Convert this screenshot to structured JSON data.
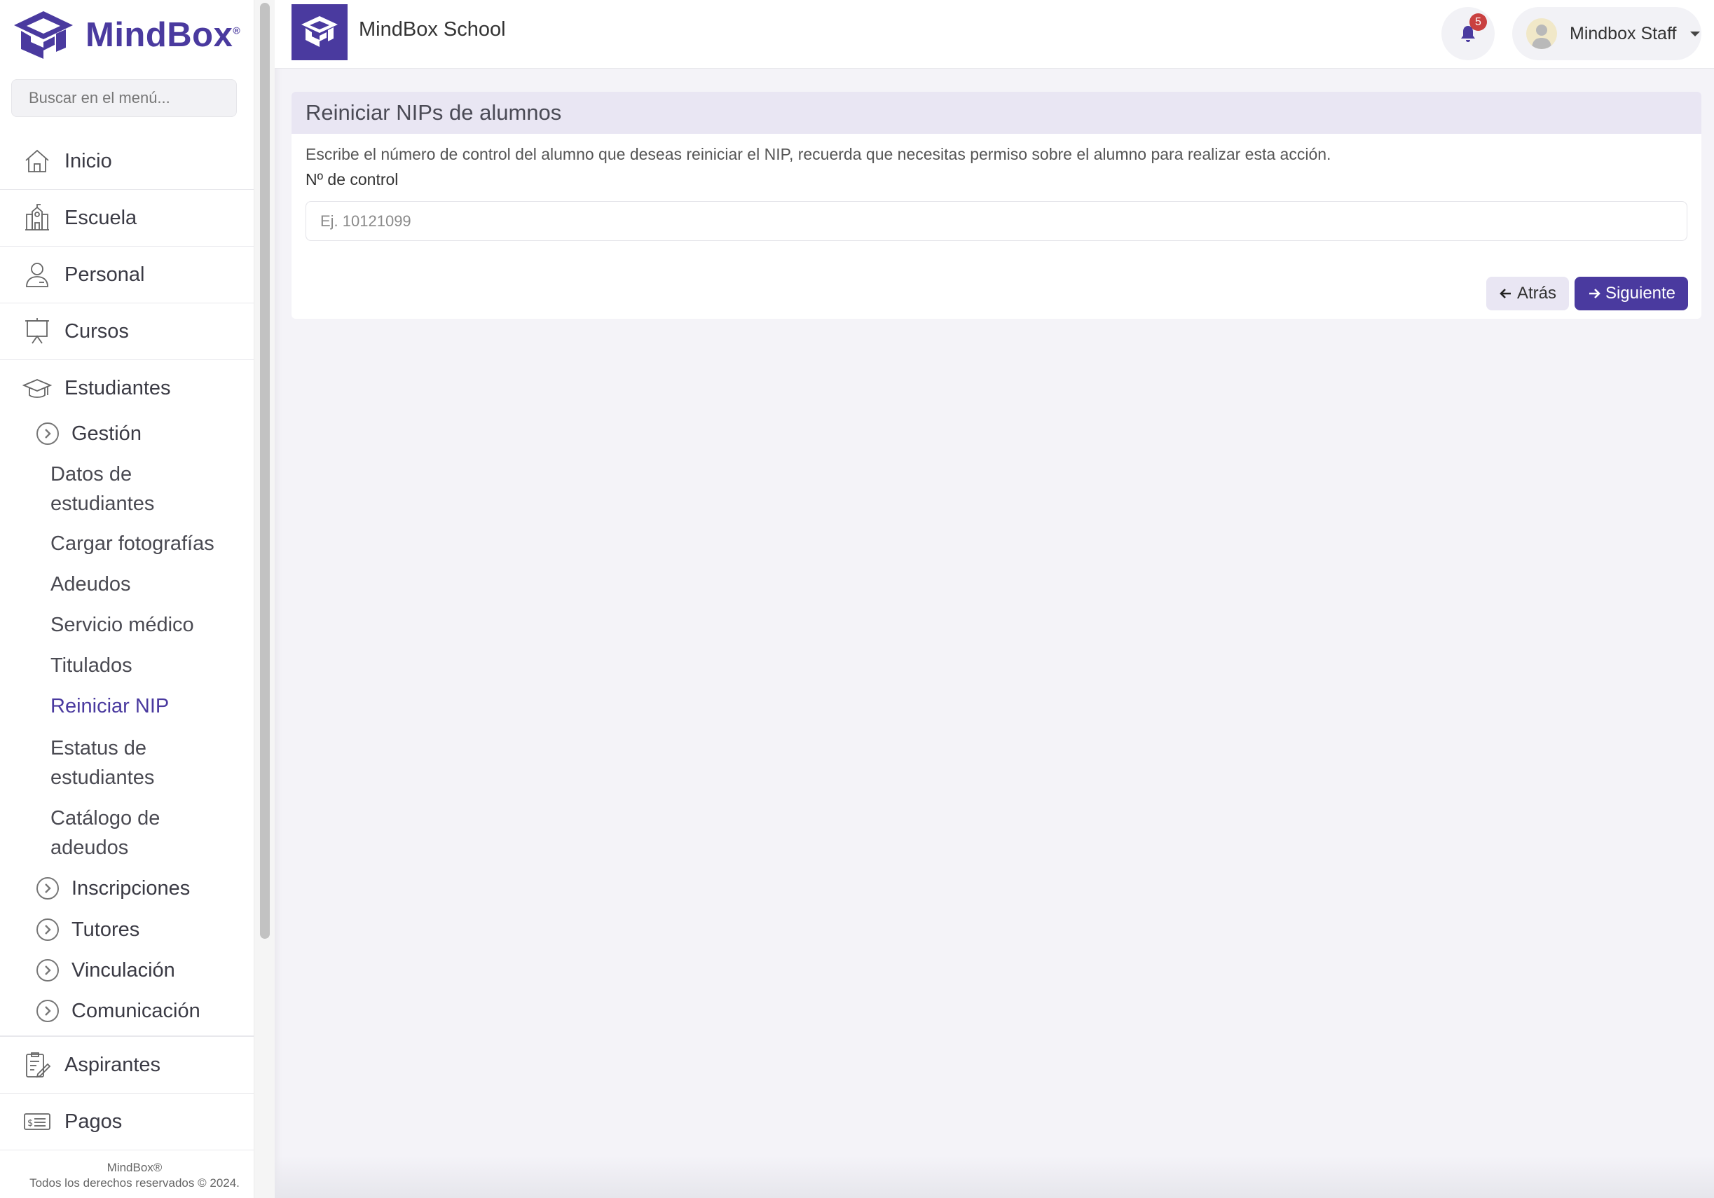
{
  "app": {
    "brand": "MindBox",
    "brand_mark": "®",
    "colors": {
      "accent": "#4a3a9f",
      "badge": "#c94040",
      "header_bg": "#e9e6f3"
    }
  },
  "sidebar": {
    "search_placeholder": "Buscar en el menú...",
    "items": [
      {
        "label": "Inicio",
        "icon": "home-icon"
      },
      {
        "label": "Escuela",
        "icon": "school-icon"
      },
      {
        "label": "Personal",
        "icon": "person-icon"
      },
      {
        "label": "Cursos",
        "icon": "presentation-icon"
      },
      {
        "label": "Estudiantes",
        "icon": "graduation-cap-icon"
      },
      {
        "label": "Aspirantes",
        "icon": "clipboard-edit-icon"
      },
      {
        "label": "Pagos",
        "icon": "payment-icon"
      }
    ],
    "estudiantes": {
      "gestion_label": "Gestión",
      "links": [
        "Datos de estudiantes",
        "Cargar fotografías",
        "Adeudos",
        "Servicio médico",
        "Titulados",
        "Reiniciar NIP",
        "Estatus de estudiantes",
        "Catálogo de adeudos"
      ],
      "active_link": "Reiniciar NIP",
      "groups": [
        "Inscripciones",
        "Tutores",
        "Vinculación",
        "Comunicación"
      ]
    },
    "footer": {
      "line1": "MindBox®",
      "line2": "Todos los derechos reservados © 2024."
    }
  },
  "header": {
    "school_name": "MindBox School",
    "notifications_count": "5",
    "user_name": "Mindbox Staff"
  },
  "main": {
    "card_title": "Reiniciar NIPs de alumnos",
    "description": "Escribe el número de control del alumno que deseas reiniciar el NIP, recuerda que necesitas permiso sobre el alumno para realizar esta acción.",
    "field_label": "Nº de control",
    "field_placeholder": "Ej. 10121099",
    "field_value": "",
    "back_label": "Atrás",
    "next_label": "Siguiente"
  }
}
